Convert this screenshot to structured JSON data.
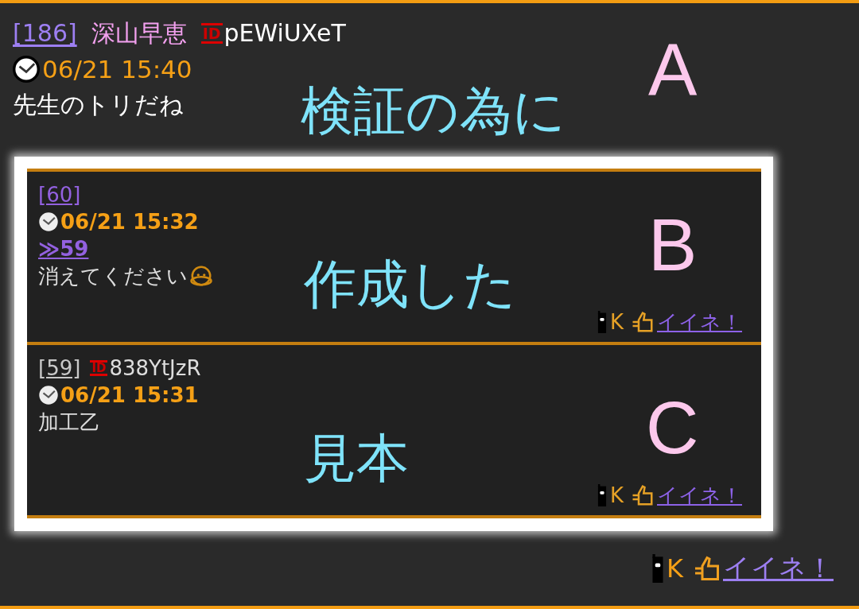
{
  "post": {
    "number": "[186]",
    "color": "#9d7ff2",
    "name": "深山早恵",
    "id_badge": "ID",
    "id": "pEWiUXeT",
    "date": "06/21 15:40",
    "body": "先生のトリだね",
    "footer": {
      "carrier": "K",
      "like": "イイネ！"
    }
  },
  "embedded_screenshot": {
    "posts": [
      {
        "number": "[60]",
        "color": "#9361e0",
        "date": "06/21 15:32",
        "reply_link": "≫59",
        "body": "消えてください",
        "emoji": true,
        "footer": {
          "carrier": "K",
          "like": "イイネ！"
        }
      },
      {
        "number": "[59]",
        "color": "#c9c9c9",
        "id_badge": "ID",
        "id": "838YtJzR",
        "date": "06/21 15:31",
        "body": "加工乙",
        "emoji": false,
        "footer": {
          "carrier": "K",
          "like": "イイネ！"
        }
      }
    ]
  },
  "annotations": [
    {
      "letter": "A",
      "caption": "検証の為に"
    },
    {
      "letter": "B",
      "caption": "作成した"
    },
    {
      "letter": "C",
      "caption": "見本"
    }
  ]
}
